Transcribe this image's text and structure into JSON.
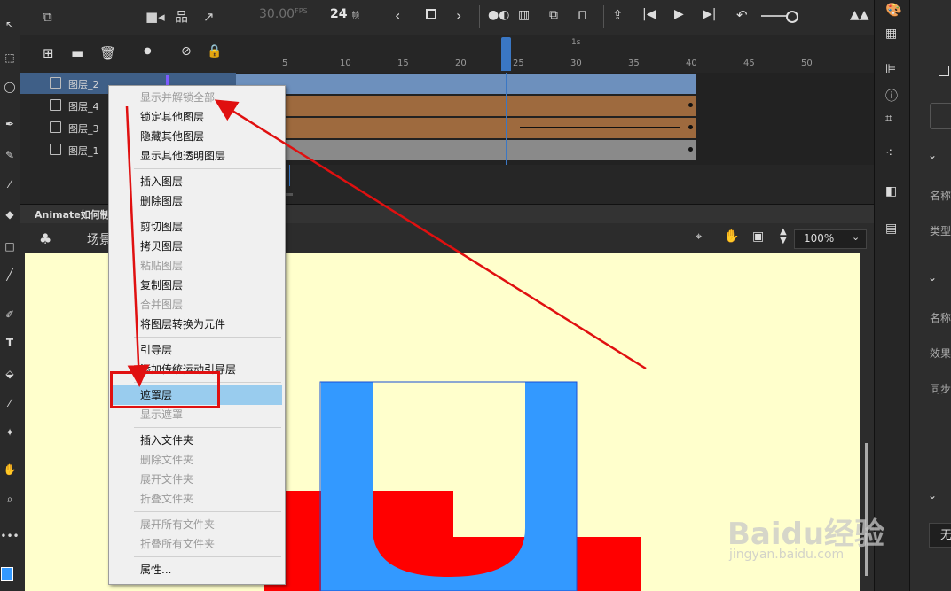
{
  "timeline": {
    "fps_value": "30.00",
    "fps_unit": "FPS",
    "frame_value": "24",
    "frame_unit": "帧",
    "ruler_marker": "1s",
    "ruler_numbers": [
      "5",
      "10",
      "15",
      "20",
      "25",
      "30",
      "35",
      "40",
      "45",
      "50"
    ]
  },
  "layers": [
    {
      "name": "图层_2",
      "selected": true,
      "color": "#7d5cff"
    },
    {
      "name": "图层_4",
      "selected": false,
      "color": "#a66b3b"
    },
    {
      "name": "图层_3",
      "selected": false,
      "color": "#a66b3b"
    },
    {
      "name": "图层_1",
      "selected": false,
      "color": "#8a8a8a"
    }
  ],
  "frame_colors": {
    "layer2": "#6d90bd",
    "layer4": "#9e6a3e",
    "layer3": "#9e6a3e",
    "layer1": "#8a8a8a"
  },
  "document": {
    "tab_title": "Animate如何制作",
    "scene_label": "场景",
    "zoom_value": "100%"
  },
  "context_menu": {
    "items": [
      {
        "label": "显示并解锁全部",
        "enabled": false
      },
      {
        "label": "锁定其他图层",
        "enabled": true
      },
      {
        "label": "隐藏其他图层",
        "enabled": true
      },
      {
        "label": "显示其他透明图层",
        "enabled": true
      },
      {
        "label": "插入图层",
        "enabled": true
      },
      {
        "label": "删除图层",
        "enabled": true
      },
      {
        "label": "剪切图层",
        "enabled": true
      },
      {
        "label": "拷贝图层",
        "enabled": true
      },
      {
        "label": "粘贴图层",
        "enabled": false
      },
      {
        "label": "复制图层",
        "enabled": true
      },
      {
        "label": "合并图层",
        "enabled": false
      },
      {
        "label": "将图层转换为元件",
        "enabled": true
      },
      {
        "label": "引导层",
        "enabled": true
      },
      {
        "label": "添加传统运动引导层",
        "enabled": true
      },
      {
        "label": "遮罩层",
        "enabled": true,
        "highlighted": true
      },
      {
        "label": "显示遮罩",
        "enabled": false
      },
      {
        "label": "插入文件夹",
        "enabled": true
      },
      {
        "label": "删除文件夹",
        "enabled": false
      },
      {
        "label": "展开文件夹",
        "enabled": false
      },
      {
        "label": "折叠文件夹",
        "enabled": false
      },
      {
        "label": "展开所有文件夹",
        "enabled": false
      },
      {
        "label": "折叠所有文件夹",
        "enabled": false
      },
      {
        "label": "属性...",
        "enabled": true
      }
    ]
  },
  "right_panel": {
    "labels": [
      "名称",
      "类型",
      "名称",
      "效果",
      "同步"
    ],
    "select_value": "无"
  },
  "watermark": {
    "text": "Baidu经验",
    "url": "jingyan.baidu.com"
  },
  "colors": {
    "accent": "#3f5f87",
    "highlight": "#99ccee",
    "annotation": "#e01010",
    "stage": "#ffffcc",
    "shape_blue": "#3399ff",
    "shape_red": "#ff0000"
  }
}
